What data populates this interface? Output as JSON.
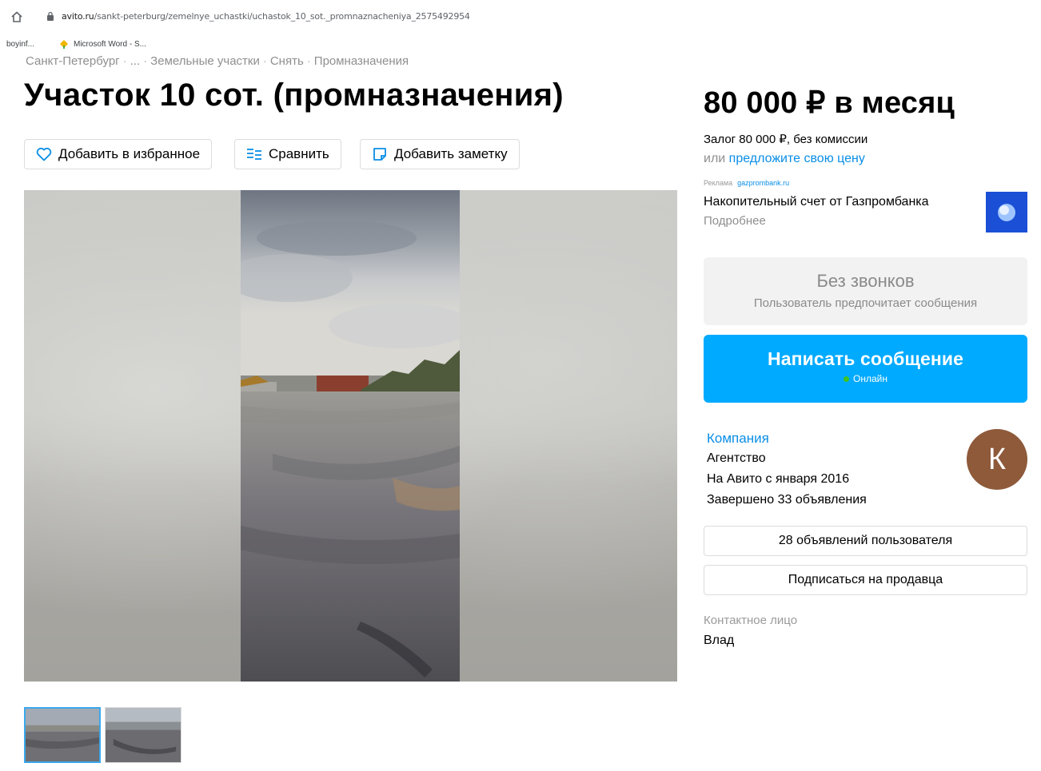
{
  "browser": {
    "url_host": "avito.ru",
    "url_path": "/sankt-peterburg/zemelnye_uchastki/uchastok_10_sot._promnaznacheniya_2575492954",
    "bookmarks": [
      "boyinf...",
      "Microsoft Word - S..."
    ]
  },
  "breadcrumb": {
    "items": [
      "Санкт-Петербург",
      "...",
      "Земельные участки",
      "Снять",
      "Промназначения"
    ],
    "separator": "·"
  },
  "title": "Участок 10 сот. (промназначения)",
  "actions": {
    "favorite": "Добавить в избранное",
    "compare": "Сравнить",
    "note": "Добавить заметку"
  },
  "gallery": {
    "thumbnail_count": 2,
    "selected_index": 0
  },
  "price": {
    "amount": "80 000 ₽ в месяц",
    "deposit": "Залог 80 000 ₽, без комиссии",
    "offer_prefix": "или",
    "offer_link": "предложите свою цену"
  },
  "ad": {
    "label": "Реклама",
    "domain": "gazprombank.ru",
    "title": "Накопительный счет от Газпромбанка",
    "more": "Подробнее"
  },
  "contact": {
    "no_calls_title": "Без звонков",
    "no_calls_subtitle": "Пользователь предпочитает сообщения",
    "write_button": "Написать сообщение",
    "online_status": "Онлайн"
  },
  "seller": {
    "type": "Компания",
    "kind": "Агентство",
    "since": "На Авито с января 2016",
    "completed": "Завершено 33 объявления",
    "avatar_letter": "К",
    "listings_button": "28 объявлений пользователя",
    "subscribe_button": "Подписаться на продавца",
    "contact_label": "Контактное лицо",
    "contact_name": "Влад"
  },
  "colors": {
    "accent_blue": "#00aaff",
    "link_blue": "#0a8ee6",
    "online_green": "#3ec41f",
    "avatar_brown": "#8e5a3a"
  }
}
